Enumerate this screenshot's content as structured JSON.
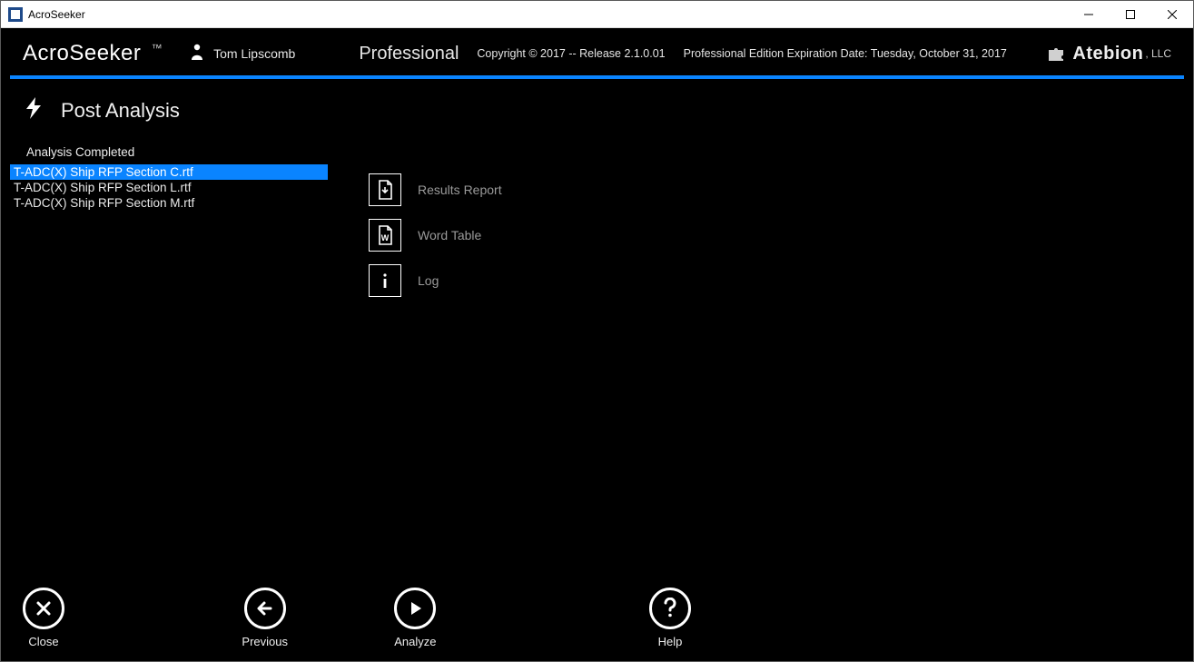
{
  "window": {
    "title": "AcroSeeker"
  },
  "header": {
    "app_name": "AcroSeeker",
    "trademark": "™",
    "user_name": "Tom Lipscomb",
    "edition": "Professional",
    "copyright": "Copyright © 2017 -- Release 2.1.0.01",
    "expiration": "Professional Edition Expiration Date: Tuesday, October 31, 2017",
    "company_name": "Atebion",
    "company_suffix": ", LLC"
  },
  "page": {
    "title": "Post Analysis",
    "section_label": "Analysis Completed",
    "files": [
      {
        "name": "T-ADC(X) Ship RFP Section C.rtf",
        "selected": true
      },
      {
        "name": "T-ADC(X) Ship RFP Section L.rtf",
        "selected": false
      },
      {
        "name": "T-ADC(X) Ship RFP Section M.rtf",
        "selected": false
      }
    ],
    "actions": [
      {
        "id": "results-report",
        "label": "Results Report",
        "icon": "document-arrow-icon"
      },
      {
        "id": "word-table",
        "label": "Word Table",
        "icon": "word-document-icon"
      },
      {
        "id": "log",
        "label": "Log",
        "icon": "info-icon"
      }
    ]
  },
  "footer": {
    "close": "Close",
    "previous": "Previous",
    "analyze": "Analyze",
    "help": "Help"
  }
}
